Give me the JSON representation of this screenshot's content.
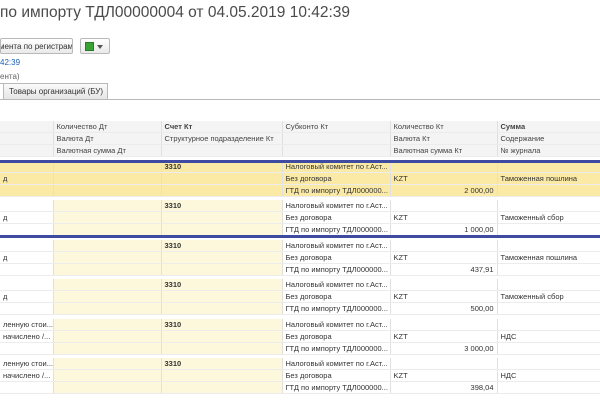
{
  "window": {
    "title": "по импорту ТДЛ00000004 от 04.05.2019 10:42:39"
  },
  "toolbar": {
    "registers_label": "ментa по регистрам"
  },
  "subtitle": {
    "line1": "42:39",
    "line2": "ента)"
  },
  "tabs": [
    {
      "label": ""
    },
    {
      "label": "Товары организаций (БУ)"
    }
  ],
  "table": {
    "header": [
      [
        "",
        "Количество Дт",
        "Счет Кт",
        "Субконто Кт",
        "Количество Кт",
        "Сумма"
      ],
      [
        "",
        "Валюта Дт",
        "Структурное подразделение Кт",
        "",
        "Валюта Кт",
        "Содержание"
      ],
      [
        "",
        "Валютная сумма Дт",
        "",
        "",
        "Валютная сумма Кт",
        "№ журнала"
      ]
    ],
    "groups": [
      {
        "rows": [
          [
            "",
            "",
            "3310",
            "Налоговый комитет по г.Аст...",
            "",
            ""
          ],
          [
            "д",
            "",
            "",
            "Без договора",
            "KZT",
            "Таможенная пошлина"
          ],
          [
            "",
            "",
            "",
            "ГТД по импорту ТДЛ000000...",
            "2 000,00",
            ""
          ]
        ]
      },
      {
        "rows": [
          [
            "",
            "",
            "3310",
            "Налоговый комитет по г.Аст...",
            "",
            ""
          ],
          [
            "д",
            "",
            "",
            "Без договора",
            "KZT",
            "Таможенный сбор"
          ],
          [
            "",
            "",
            "",
            "ГТД по импорту ТДЛ000000...",
            "1 000,00",
            ""
          ]
        ]
      },
      {
        "rows": [
          [
            "",
            "",
            "3310",
            "Налоговый комитет по г.Аст...",
            "",
            ""
          ],
          [
            "д",
            "",
            "",
            "Без договора",
            "KZT",
            "Таможенная пошлина"
          ],
          [
            "",
            "",
            "",
            "ГТД по импорту ТДЛ000000...",
            "437,91",
            ""
          ]
        ]
      },
      {
        "rows": [
          [
            "",
            "",
            "3310",
            "Налоговый комитет по г.Аст...",
            "",
            ""
          ],
          [
            "д",
            "",
            "",
            "Без договора",
            "KZT",
            "Таможенный сбор"
          ],
          [
            "",
            "",
            "",
            "ГТД по импорту ТДЛ000000...",
            "500,00",
            ""
          ]
        ]
      },
      {
        "rows": [
          [
            "ленную стои...",
            "",
            "3310",
            "Налоговый комитет по г.Аст...",
            "",
            ""
          ],
          [
            "начислено /...",
            "",
            "",
            "Без договора",
            "KZT",
            "НДС"
          ],
          [
            "",
            "",
            "",
            "ГТД по импорту ТДЛ000000...",
            "3 000,00",
            ""
          ]
        ]
      },
      {
        "rows": [
          [
            "ленную стои...",
            "",
            "3310",
            "Налоговый комитет по г.Аст...",
            "",
            ""
          ],
          [
            "начислено /...",
            "",
            "",
            "Без договора",
            "KZT",
            "НДС"
          ],
          [
            "",
            "",
            "",
            "ГТД по импорту ТДЛ000000...",
            "398,04",
            ""
          ]
        ]
      }
    ]
  },
  "colors": {
    "accent_bar": "#3f4aa1",
    "selected_row": "#fbeaa6",
    "cell_highlight": "#fdf8dc"
  },
  "icons": {
    "registers": "register-icon",
    "more": "green-cube-icon"
  }
}
